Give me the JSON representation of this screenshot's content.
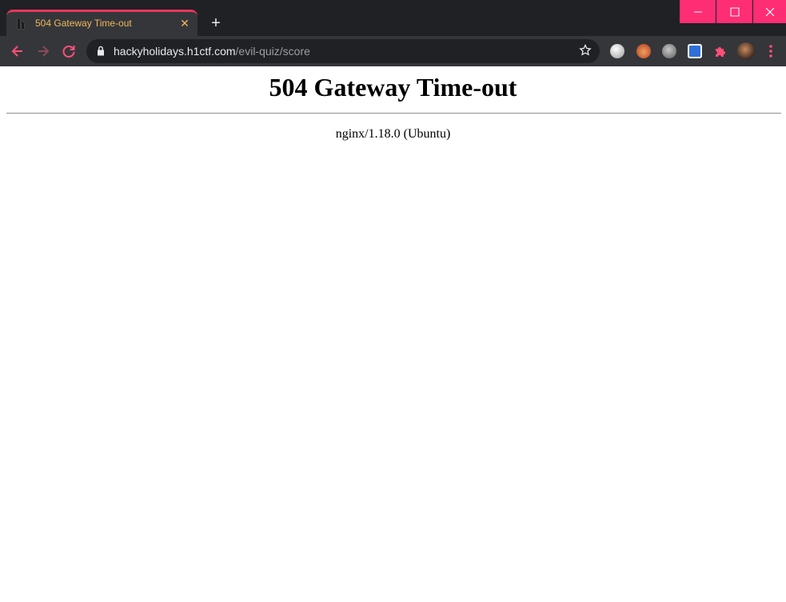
{
  "tab": {
    "title": "504 Gateway Time-out",
    "favicon_glyph": "h"
  },
  "address_bar": {
    "host": "hackyholidays.h1ctf.com",
    "path": "/evil-quiz/score"
  },
  "page": {
    "heading": "504 Gateway Time-out",
    "server": "nginx/1.18.0 (Ubuntu)"
  },
  "colors": {
    "accent": "#ff2d74",
    "tab_title": "#f0b85a",
    "chrome_dark": "#202124",
    "chrome_toolbar": "#35363a"
  },
  "icons": [
    "back-icon",
    "forward-icon",
    "reload-icon",
    "lock-icon",
    "star-icon",
    "puzzle-extension-icon",
    "kebab-menu-icon"
  ]
}
